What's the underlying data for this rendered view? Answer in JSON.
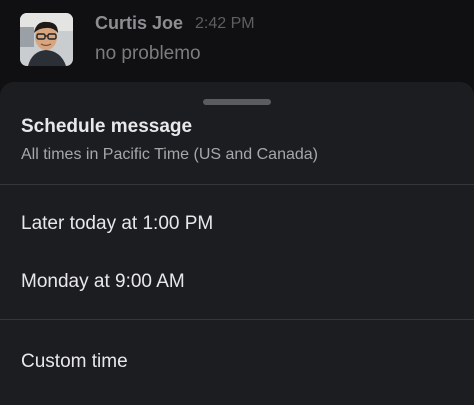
{
  "message": {
    "sender_name": "Curtis Joe",
    "time": "2:42 PM",
    "text": "no problemo",
    "avatar_icon": "user-photo"
  },
  "schedule_sheet": {
    "title": "Schedule message",
    "subtitle": "All times in Pacific Time (US and Canada)",
    "options": [
      {
        "label": "Later today at 1:00 PM"
      },
      {
        "label": "Monday at 9:00 AM"
      }
    ],
    "custom_label": "Custom time"
  },
  "colors": {
    "background": "#121212",
    "sheet": "#1b1d21",
    "text_primary": "#e8e8ea",
    "text_secondary": "#a6a7ab",
    "divider": "#34363a"
  }
}
